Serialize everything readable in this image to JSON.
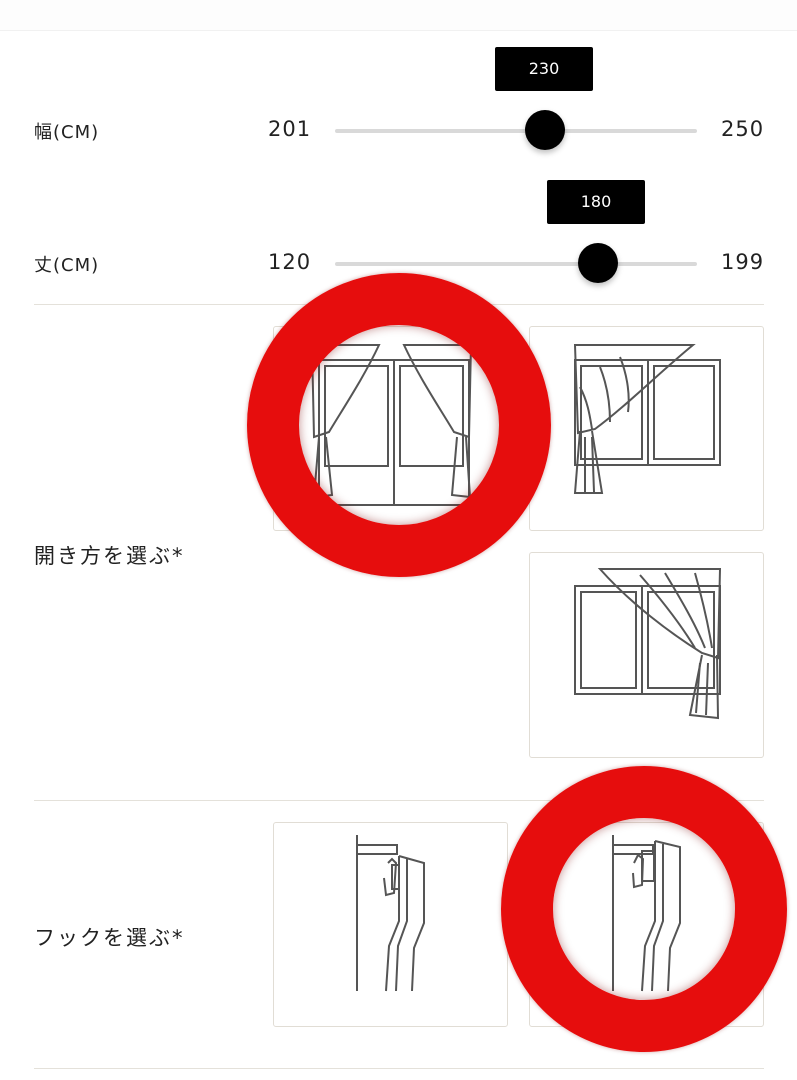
{
  "width_slider": {
    "label": "幅(CM)",
    "min_label": "201",
    "max_label": "250",
    "value_label": "230",
    "min": 201,
    "max": 250,
    "value": 230
  },
  "height_slider": {
    "label": "丈(CM)",
    "min_label": "120",
    "max_label": "199",
    "value_label": "180",
    "min": 120,
    "max": 199,
    "value": 180
  },
  "opening": {
    "label": "開き方を選ぶ*",
    "options": [
      {
        "icon": "curtain-both-sides-icon"
      },
      {
        "icon": "curtain-left-side-icon"
      },
      {
        "icon": "curtain-right-side-icon"
      }
    ]
  },
  "hook": {
    "label": "フックを選ぶ*",
    "options": [
      {
        "icon": "hook-type-a-icon"
      },
      {
        "icon": "hook-type-b-icon"
      }
    ]
  },
  "colors": {
    "track": "#d9d9d9",
    "thumb": "#000000",
    "highlight_ring": "#e60d0d",
    "divider": "#e4e1da",
    "card_border": "#e1ddd5"
  }
}
